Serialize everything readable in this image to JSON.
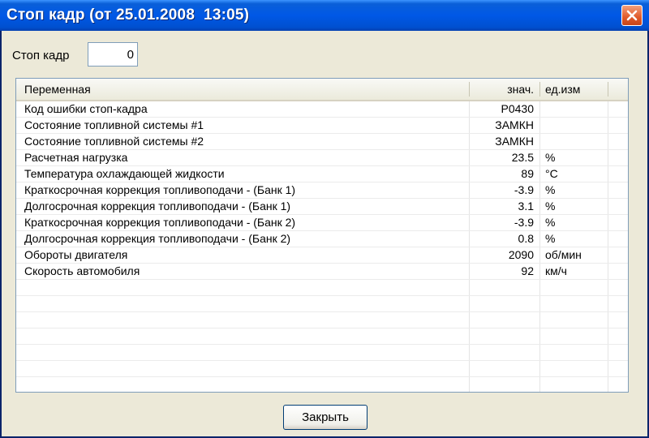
{
  "window": {
    "title": "Стоп кадр (от 25.01.2008  13:05)"
  },
  "frame_field": {
    "label": "Стоп кадр",
    "value": "0"
  },
  "table": {
    "columns": [
      "Переменная",
      "знач.",
      "ед.изм"
    ],
    "rows": [
      {
        "name": "Код ошибки стоп-кадра",
        "value": "P0430",
        "unit": ""
      },
      {
        "name": "Состояние топливной системы #1",
        "value": "ЗАМКН",
        "unit": ""
      },
      {
        "name": "Состояние топливной системы #2",
        "value": "ЗАМКН",
        "unit": ""
      },
      {
        "name": "Расчетная нагрузка",
        "value": "23.5",
        "unit": "%"
      },
      {
        "name": "Температура охлаждающей жидкости",
        "value": "89",
        "unit": "°C"
      },
      {
        "name": "Краткосрочная коррекция топливоподачи - (Банк 1)",
        "value": "-3.9",
        "unit": "%"
      },
      {
        "name": "Долгосрочная коррекция топливоподачи - (Банк 1)",
        "value": "3.1",
        "unit": "%"
      },
      {
        "name": "Краткосрочная коррекция топливоподачи - (Банк 2)",
        "value": "-3.9",
        "unit": "%"
      },
      {
        "name": "Долгосрочная коррекция топливоподачи - (Банк 2)",
        "value": "0.8",
        "unit": "%"
      },
      {
        "name": "Обороты двигателя",
        "value": "2090",
        "unit": "об/мин"
      },
      {
        "name": "Скорость автомобиля",
        "value": "92",
        "unit": "км/ч"
      },
      {
        "name": "",
        "value": "",
        "unit": ""
      },
      {
        "name": "",
        "value": "",
        "unit": ""
      },
      {
        "name": "",
        "value": "",
        "unit": ""
      },
      {
        "name": "",
        "value": "",
        "unit": ""
      },
      {
        "name": "",
        "value": "",
        "unit": ""
      },
      {
        "name": "",
        "value": "",
        "unit": ""
      },
      {
        "name": "",
        "value": "",
        "unit": ""
      }
    ]
  },
  "buttons": {
    "close_label": "Закрыть"
  },
  "icons": {
    "title_close": "close-icon"
  },
  "colors": {
    "titlebar": "#0058e6",
    "window_bg": "#ece9d8",
    "close_button": "#e05a2a"
  }
}
